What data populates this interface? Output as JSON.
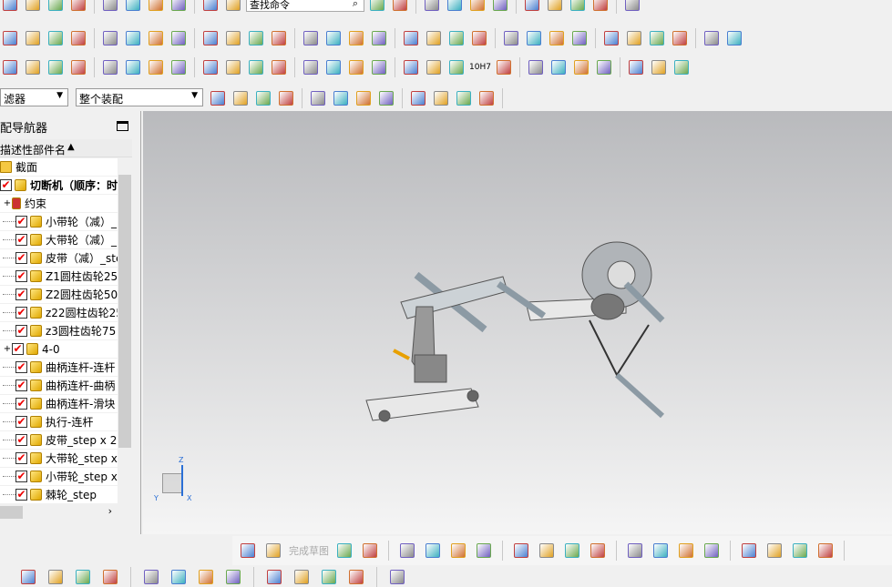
{
  "toolbar": {
    "search_placeholder": "查找命令",
    "row1_icons": [
      "new-icon",
      "open-icon",
      "save-icon",
      "cut-icon",
      "copy-icon",
      "paste-icon",
      "undo-icon",
      "redo-icon",
      "select-icon",
      "command-finder-icon"
    ],
    "row1_right_icons": [
      "fit-icon",
      "view-orient-icon",
      "render-style-icon",
      "section-icon",
      "layer-icon",
      "color-icon",
      "move-icon",
      "component-icon",
      "list-icon",
      "info-icon",
      "measure-icon"
    ],
    "row2_icons": [
      "extrude-icon",
      "revolve-icon",
      "block-icon",
      "cylinder-icon",
      "cone-icon",
      "sphere-icon",
      "hole-icon",
      "boss-icon",
      "pattern-icon",
      "unite-icon",
      "subtract-icon",
      "intersect-icon",
      "trim-icon",
      "split-icon",
      "shell-icon",
      "blend-icon",
      "chamfer-icon",
      "draft-icon",
      "offset-icon",
      "thicken-icon",
      "scale-icon",
      "mirror-icon",
      "sweep-icon",
      "loft-icon",
      "surface-icon",
      "mesh-icon",
      "patch-icon",
      "sew-icon",
      "analysis-icon",
      "curve-icon"
    ],
    "row3_icons": [
      "table-icon",
      "spreadsheet-icon",
      "sketch-icon",
      "assembly-add-icon",
      "constraint-icon",
      "reposition-icon",
      "text-icon",
      "wave-icon",
      "surface-check-icon",
      "spring-icon",
      "bearing-icon",
      "thread-icon",
      "triangle-icon",
      "grid-icon",
      "edit-icon",
      "group-icon",
      "drawing-icon",
      "brush-icon",
      "tolerance-icon",
      "packed-icon",
      "explode-icon",
      "line-icon",
      "arc-icon",
      "spline-icon",
      "point-icon",
      "datum-icon",
      "fit-curve-icon"
    ],
    "tolerance_label": "10H7",
    "filter_select": "滤器",
    "scope_select": "整个装配",
    "snap_icons": [
      "snap-grid-icon",
      "snap-endpoint-icon",
      "snap-midpoint-icon",
      "snap-tangent-icon",
      "snap-intersect-icon",
      "snap-quadrant-icon",
      "snap-center-icon",
      "snap-circle-icon",
      "snap-point-icon",
      "snap-onCurve-icon",
      "snap-face-icon",
      "snap-bar-icon"
    ]
  },
  "navigator": {
    "title": "配导航器",
    "column_header": "描述性部件名",
    "items": [
      {
        "label": "截面",
        "type": "folder",
        "checked": false,
        "expand": ""
      },
      {
        "label": "切断机（顺序：时",
        "type": "assembly",
        "checked": true,
        "expand": ""
      },
      {
        "label": "约束",
        "type": "constraint",
        "checked": false,
        "expand": "+"
      },
      {
        "label": "小带轮（减）_",
        "type": "part",
        "checked": true
      },
      {
        "label": "大带轮（减）_",
        "type": "part",
        "checked": true
      },
      {
        "label": "皮带（减）_ste",
        "type": "part",
        "checked": true
      },
      {
        "label": "Z1圆柱齿轮25",
        "type": "part",
        "checked": true
      },
      {
        "label": "Z2圆柱齿轮50",
        "type": "part",
        "checked": true
      },
      {
        "label": "z22圆柱齿轮25",
        "type": "part",
        "checked": true
      },
      {
        "label": "z3圆柱齿轮75",
        "type": "part",
        "checked": true
      },
      {
        "label": "4-0",
        "type": "assembly",
        "checked": true,
        "expand": "+"
      },
      {
        "label": "曲柄连杆-连杆",
        "type": "part",
        "checked": true
      },
      {
        "label": "曲柄连杆-曲柄",
        "type": "part",
        "checked": true
      },
      {
        "label": "曲柄连杆-滑块",
        "type": "part",
        "checked": true
      },
      {
        "label": "执行-连杆",
        "type": "part",
        "checked": true
      },
      {
        "label": "皮带_step x 2",
        "type": "part",
        "checked": true
      },
      {
        "label": "大带轮_step x",
        "type": "part",
        "checked": true
      },
      {
        "label": "小带轮_step x",
        "type": "part",
        "checked": true
      },
      {
        "label": "棘轮_step",
        "type": "part",
        "checked": true
      }
    ]
  },
  "triad": {
    "x": "X",
    "y": "Y",
    "z": "Z"
  },
  "sketch_toolbar": {
    "finish_label": "完成草图",
    "icons": [
      "sketch-task-icon",
      "finish-sketch-icon",
      "profile-icon",
      "sketch-line-icon",
      "sketch-arc-icon",
      "sketch-circle-icon",
      "sketch-fillet-icon",
      "sketch-chamfer-icon",
      "sketch-rectangle-icon",
      "sketch-polygon-icon",
      "sketch-point-icon",
      "sketch-studio-icon",
      "quick-trim-icon",
      "quick-extend-icon",
      "make-corner-icon",
      "offset-curve-icon",
      "pattern-curve-icon",
      "mirror-curve-icon",
      "dimension-icon",
      "geometric-constraint-icon"
    ]
  },
  "bottom_toolbar": {
    "icons": [
      "assembly-nav-icon",
      "new-component-icon",
      "add-component-icon",
      "move-component-icon",
      "assembly-constraint-icon",
      "mate-icon",
      "wave-linker-icon",
      "exploded-view-icon",
      "assembly-clearance-icon",
      "sequence-icon",
      "cable-icon",
      "routing-icon",
      "arrangement-icon"
    ]
  },
  "colors": {
    "accent": "#2a6fd6",
    "check": "#e00000",
    "viewport_top": "#b9babd",
    "viewport_bottom": "#f5f5f5"
  }
}
